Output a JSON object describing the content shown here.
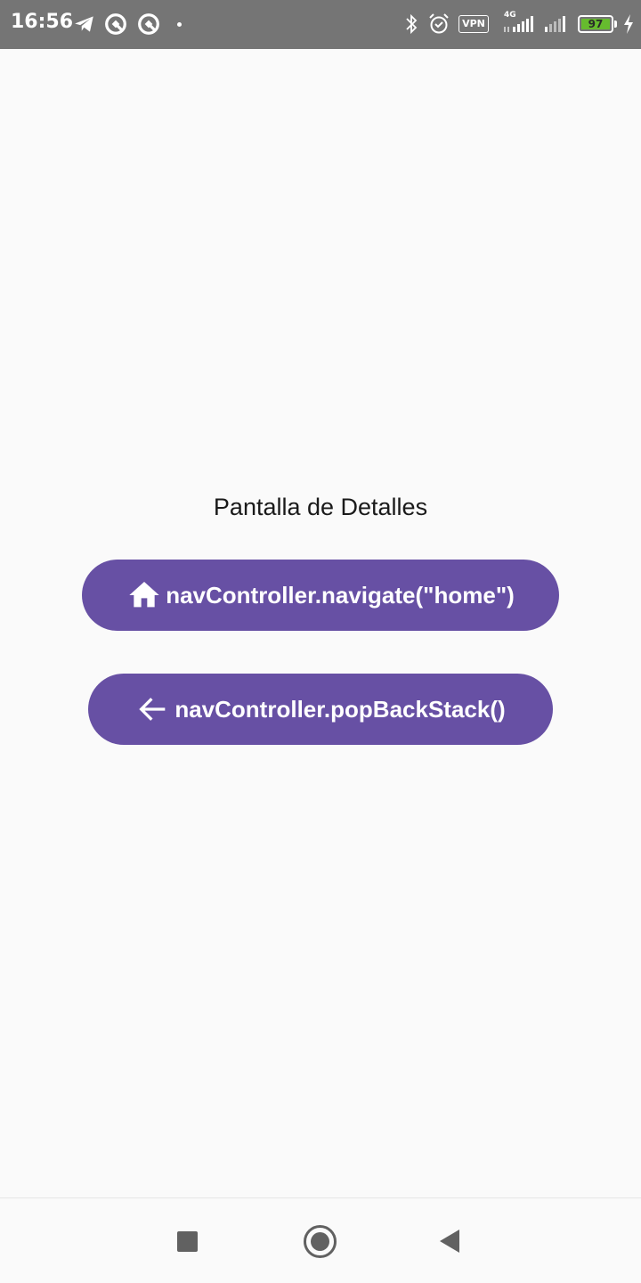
{
  "status_bar": {
    "time": "16:56",
    "vpn_label": "VPN",
    "network_label": "4G",
    "battery_level": "97",
    "icons": [
      "telegram-icon",
      "app-icon",
      "app-icon",
      "notification-dot-icon",
      "bluetooth-icon",
      "alarm-icon",
      "vpn-icon",
      "signal-icon",
      "signal-icon",
      "battery-icon",
      "charging-icon"
    ],
    "background_color": "#757575",
    "battery_color": "#66bb2e"
  },
  "screen": {
    "title": "Pantalla de Detalles",
    "background_color": "#fafafa"
  },
  "buttons": {
    "home": {
      "label": "navController.navigate(\"home\")",
      "icon": "home-icon",
      "color": "#6750a4"
    },
    "back": {
      "label": "navController.popBackStack()",
      "icon": "arrow-back-icon",
      "color": "#6750a4"
    }
  },
  "nav_bar": {
    "icons": [
      "recent-apps-icon",
      "home-nav-icon",
      "back-nav-icon"
    ]
  }
}
